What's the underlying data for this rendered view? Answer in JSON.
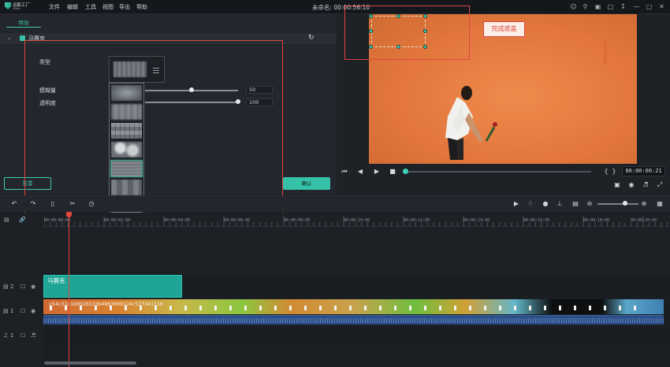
{
  "app": {
    "logo_text": "迅影工厂",
    "logo_sub": "Video",
    "title": "未命名: 00:00:56:10"
  },
  "menu": [
    "文件",
    "编辑",
    "工具",
    "视图",
    "导出",
    "帮助"
  ],
  "effects_panel": {
    "tab": "特效",
    "section_title": "马赛克",
    "type_label": "类型",
    "blur_label": "模糊量",
    "blur_value": "50",
    "opacity_label": "透明度",
    "opacity_value": "100",
    "blur_level": 0.5,
    "opacity_level": 1.0,
    "reset_button": "重置",
    "confirm_button": "确认"
  },
  "preview": {
    "callout_text": "完成遮盖",
    "timecode": "00:00:00:21",
    "progress": 0.01
  },
  "timeline": {
    "ticks": [
      "00:00:00:00",
      "00:00:02:00",
      "00:00:04:00",
      "00:00:06:00",
      "00:00:08:00",
      "00:00:10:00",
      "00:00:12:00",
      "00:00:14:00",
      "00:00:16:00",
      "00:00:18:00",
      "00:00:20:00"
    ],
    "effect_clip_label": "马赛克",
    "video_clip_label": "c54c31c1b0328133b4863009124c52fd41110",
    "track_labels": [
      "2",
      "1",
      "1"
    ]
  },
  "colors": {
    "accent": "#3fc9b3",
    "highlight": "#e0453e",
    "video_bg": "#e2763c"
  }
}
